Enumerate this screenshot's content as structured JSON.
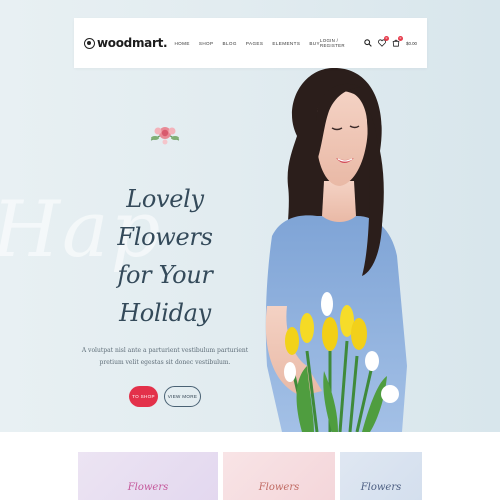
{
  "brand": {
    "logo_text": "woodmart."
  },
  "nav": {
    "items": [
      {
        "label": "HOME"
      },
      {
        "label": "SHOP"
      },
      {
        "label": "BLOG"
      },
      {
        "label": "PAGES"
      },
      {
        "label": "ELEMENTS"
      },
      {
        "label": "BUY"
      }
    ]
  },
  "header": {
    "login_label": "LOGIN / REGISTER",
    "wishlist_count": "0",
    "cart_count": "0",
    "cart_total": "$0.00"
  },
  "hero": {
    "watermark": "Hap",
    "title_line1": "Lovely Flowers",
    "title_line2": "for Your Holiday",
    "description_line1": "A volutpat nisl ante a parturient vestibulum parturient",
    "description_line2": "pretium velit egestas sit donec vestibulum.",
    "primary_button": "TO SHOP",
    "secondary_button": "VIEW MORE"
  },
  "categories": [
    {
      "label": "Flowers",
      "color": "#c4579a"
    },
    {
      "label": "Flowers",
      "color": "#c06a62"
    },
    {
      "label": "Flowers",
      "color": "#4c5e82"
    }
  ],
  "colors": {
    "accent": "#e3314a",
    "heading": "#344a5a",
    "hero_bg": "#e2ecf0"
  },
  "icons": [
    "search-icon",
    "heart-icon",
    "cart-icon",
    "logo-icon",
    "floral-icon"
  ]
}
